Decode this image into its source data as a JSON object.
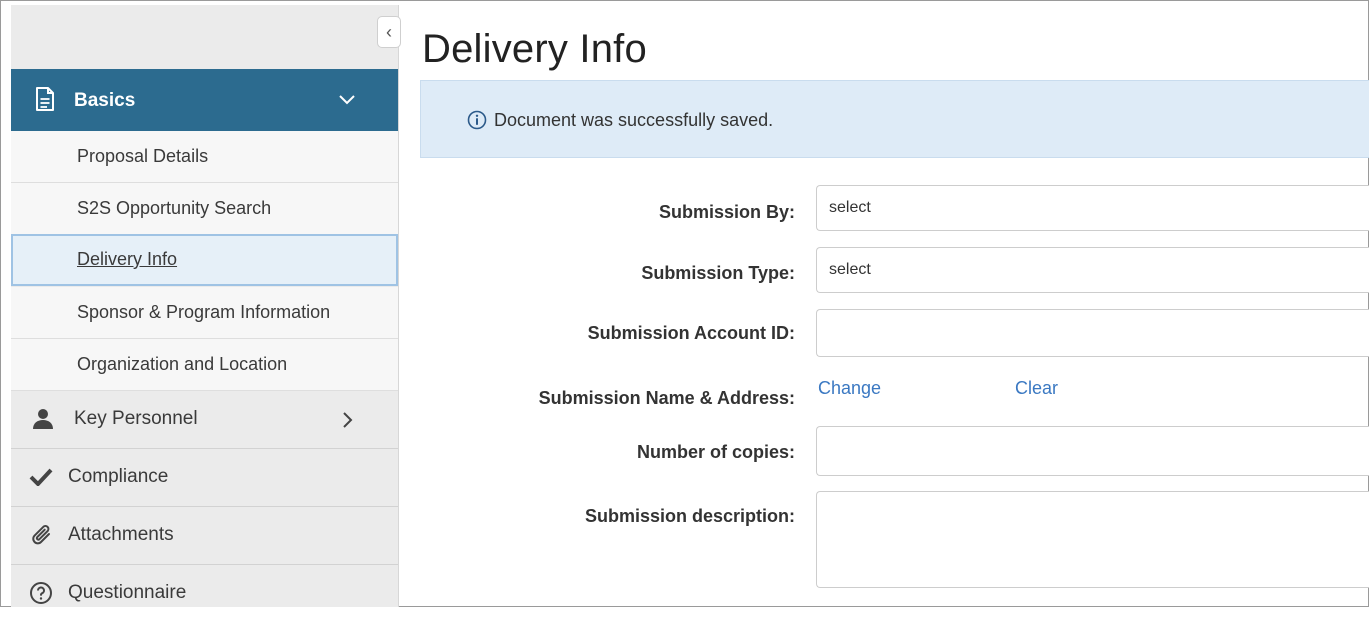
{
  "sidebar": {
    "collapse_glyph": "‹",
    "section": {
      "label": "Basics",
      "icon": "document-icon",
      "expanded": true
    },
    "sub_items": [
      {
        "label": "Proposal Details"
      },
      {
        "label": "S2S Opportunity Search"
      },
      {
        "label": "Delivery Info",
        "active": true
      },
      {
        "label": "Sponsor & Program Information"
      },
      {
        "label": "Organization and Location"
      }
    ],
    "nav_items": [
      {
        "label": "Key Personnel",
        "icon": "person-icon"
      },
      {
        "label": "Compliance",
        "icon": "checkmark-icon"
      },
      {
        "label": "Attachments",
        "icon": "paperclip-icon"
      },
      {
        "label": "Questionnaire",
        "icon": "question-circle-icon"
      }
    ]
  },
  "main": {
    "title": "Delivery Info",
    "alert": {
      "icon": "info-icon",
      "message": "Document was successfully saved."
    },
    "form": {
      "submission_by": {
        "label": "Submission By:",
        "value": "select"
      },
      "submission_type": {
        "label": "Submission Type:",
        "value": "select"
      },
      "account_id": {
        "label": "Submission Account ID:",
        "value": ""
      },
      "name_address": {
        "label": "Submission Name & Address:",
        "change": "Change",
        "clear": "Clear"
      },
      "copies": {
        "label": "Number of copies:",
        "value": ""
      },
      "description": {
        "label": "Submission description:",
        "value": ""
      }
    }
  },
  "colors": {
    "section_bg": "#2c6b8f",
    "link": "#3a78c2",
    "alert_bg": "#deebf7",
    "active_border": "#9fc3e4"
  }
}
